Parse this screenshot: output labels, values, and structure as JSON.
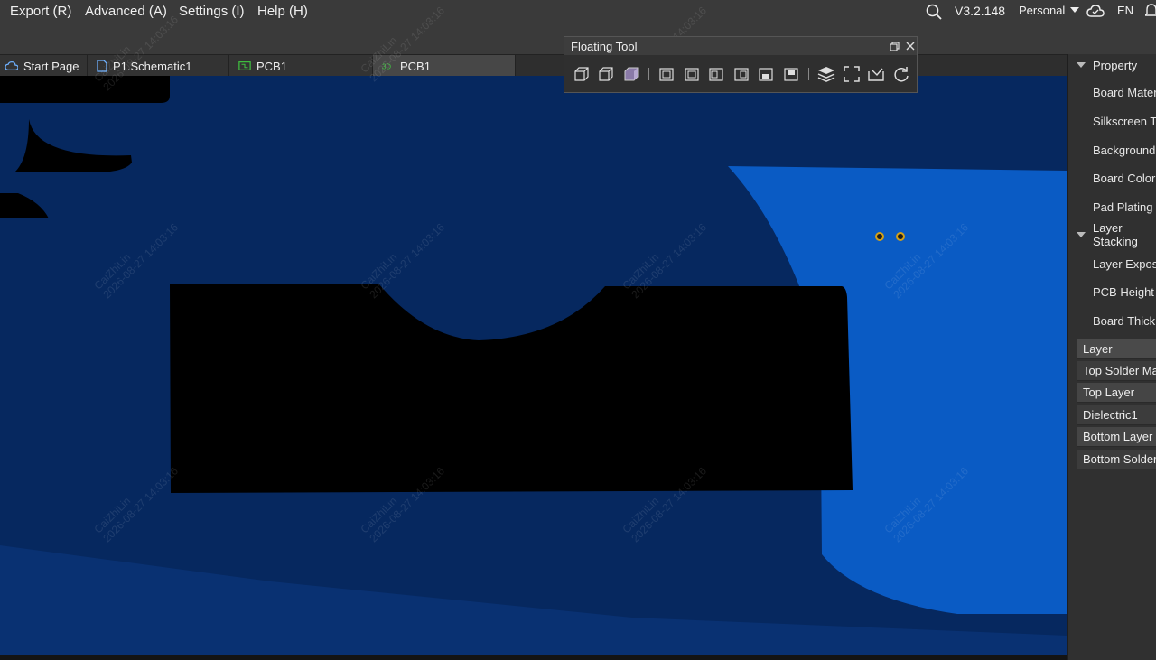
{
  "menu": {
    "export": "Export (R)",
    "advanced": "Advanced (A)",
    "settings": "Settings (I)",
    "help": "Help (H)"
  },
  "topbar": {
    "version": "V3.2.148",
    "account": "Personal",
    "language": "EN"
  },
  "tabs": [
    {
      "label": "Start Page"
    },
    {
      "label": "P1.Schematic1"
    },
    {
      "label": "PCB1"
    },
    {
      "label": "PCB1"
    }
  ],
  "floating_tool": {
    "title": "Floating Tool"
  },
  "property_panel": {
    "property_header": "Property",
    "property_items": [
      "Board Material",
      "Silkscreen Text",
      "Background Color",
      "Board Color",
      "Pad Plating Color"
    ],
    "layer_stacking_header": "Layer Stacking",
    "layer_items": [
      "Layer Exposed",
      "PCB Height Fix",
      "Board Thickness"
    ],
    "layer_table_header": "Layer",
    "layer_rows": [
      "Top Solder Mask",
      "Top Layer",
      "Dielectric1",
      "Bottom Layer",
      "Bottom Solder Mask"
    ]
  },
  "watermark": {
    "name": "CaiZhiLin",
    "date": "2026-08-27 14:03:16"
  },
  "colors": {
    "canvas": "#06285f",
    "board_dark": "#06285f",
    "board_light": "#0a5bc4",
    "cutout": "#000000"
  }
}
